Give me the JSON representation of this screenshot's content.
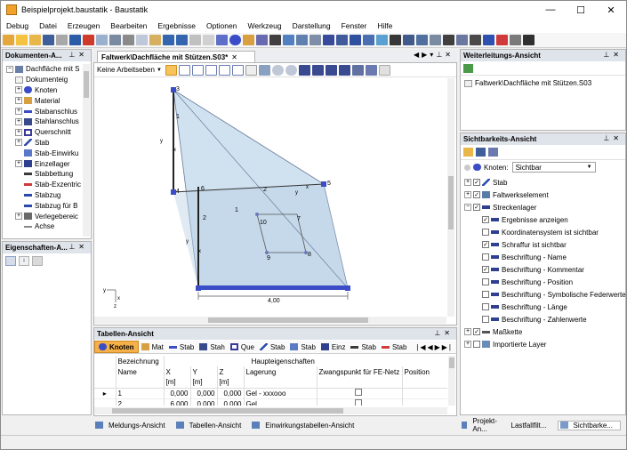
{
  "window": {
    "title": "Beispielprojekt.baustatik - Baustatik",
    "minimize_glyph": "—",
    "maximize_glyph": "☐",
    "close_glyph": "✕"
  },
  "menu": [
    "Debug",
    "Datei",
    "Erzeugen",
    "Bearbeiten",
    "Ergebnisse",
    "Optionen",
    "Werkzeug",
    "Darstellung",
    "Fenster",
    "Hilfe"
  ],
  "documents_panel": {
    "title": "Dokumenten-A...",
    "root": "Dachfläche mit S",
    "items": [
      "Dokumenteig",
      "Knoten",
      "Material",
      "Stabanschlus",
      "Stahlanschlus",
      "Querschnitt",
      "Stab",
      "Stab-Einwirku",
      "Einzellager",
      "Stabbettung",
      "Stab-Exzentric",
      "Stabzug",
      "Stabzug für B",
      "Verlegebereic",
      "Achse"
    ]
  },
  "properties_panel": {
    "title": "Eigenschaften-A..."
  },
  "doc_tab": {
    "title": "Faltwerk\\Dachfläche mit Stützen.S03*",
    "close_glyph": "✕"
  },
  "view_toolbar": {
    "selector": "Keine Arbeitseben"
  },
  "drawing": {
    "node_labels": [
      "3",
      "4",
      "5",
      "6",
      "7",
      "8",
      "9",
      "10"
    ],
    "bar_labels": [
      "1",
      "2",
      "2",
      "1"
    ],
    "dimension": "4,00",
    "axis_labels": {
      "x": "x",
      "y": "y",
      "z": "z"
    }
  },
  "forwarding_panel": {
    "title": "Weiterleitungs-Ansicht",
    "path": "Faltwerk\\Dachfläche mit Stützen.S03"
  },
  "visibility_panel": {
    "title": "Sichtbarkeits-Ansicht",
    "filter_label": "Knoten:",
    "filter_value": "Sichtbar",
    "items": [
      {
        "label": "Stab",
        "level": 0,
        "checked": true,
        "expander": "+"
      },
      {
        "label": "Faltwerkselement",
        "level": 0,
        "checked": true,
        "expander": "+"
      },
      {
        "label": "Streckenlager",
        "level": 0,
        "checked": true,
        "expander": "−"
      },
      {
        "label": "Ergebnisse anzeigen",
        "level": 1,
        "checked": true
      },
      {
        "label": "Koordinatensystem ist sichtbar",
        "level": 1,
        "checked": false
      },
      {
        "label": "Schraffur ist sichtbar",
        "level": 1,
        "checked": true
      },
      {
        "label": "Beschriftung - Name",
        "level": 1,
        "checked": false
      },
      {
        "label": "Beschriftung - Kommentar",
        "level": 1,
        "checked": true
      },
      {
        "label": "Beschriftung - Position",
        "level": 1,
        "checked": false
      },
      {
        "label": "Beschriftung - Symbolische Federwerte",
        "level": 1,
        "checked": false
      },
      {
        "label": "Beschriftung - Länge",
        "level": 1,
        "checked": false
      },
      {
        "label": "Beschriftung - Zahlenwerte",
        "level": 1,
        "checked": false
      },
      {
        "label": "Maßkette",
        "level": 0,
        "checked": true,
        "expander": "+"
      },
      {
        "label": "Importierte Layer",
        "level": 0,
        "checked": false,
        "expander": "+"
      }
    ]
  },
  "table_panel": {
    "title": "Tabellen-Ansicht",
    "tabs": [
      "Knoten",
      "Mat",
      "Stab",
      "Stah",
      "Que",
      "Stab",
      "Stab",
      "Einz",
      "Stab",
      "Stab"
    ],
    "group_header": "Haupteigenschaften",
    "columns": [
      "Bezeichnung",
      "X",
      "Y",
      "Z",
      "Lagerung",
      "Zwangspunkt für FE-Netz",
      "Position"
    ],
    "subheaders": [
      "Name",
      "[m]",
      "[m]",
      "[m]",
      "",
      "",
      ""
    ],
    "rows": [
      {
        "name": "1",
        "x": "0,000",
        "y": "0,000",
        "z": "0,000",
        "lagerung": "Gel - xxxooo"
      },
      {
        "name": "2",
        "x": "6,000",
        "y": "0,000",
        "z": "0,000",
        "lagerung": "Gel"
      }
    ]
  },
  "bottom_tabs_left": [
    "Meldungs-Ansicht",
    "Tabellen-Ansicht",
    "Einwirkungstabellen-Ansicht"
  ],
  "bottom_tabs_right": [
    "Projekt-An...",
    "Lastfallfilt...",
    "Sichtbarke..."
  ],
  "colors": {
    "accent": "#f0a030",
    "panel_header": "#dfe3ea",
    "plate_fill": "#c8dcec",
    "support": "#3a4cc8"
  }
}
